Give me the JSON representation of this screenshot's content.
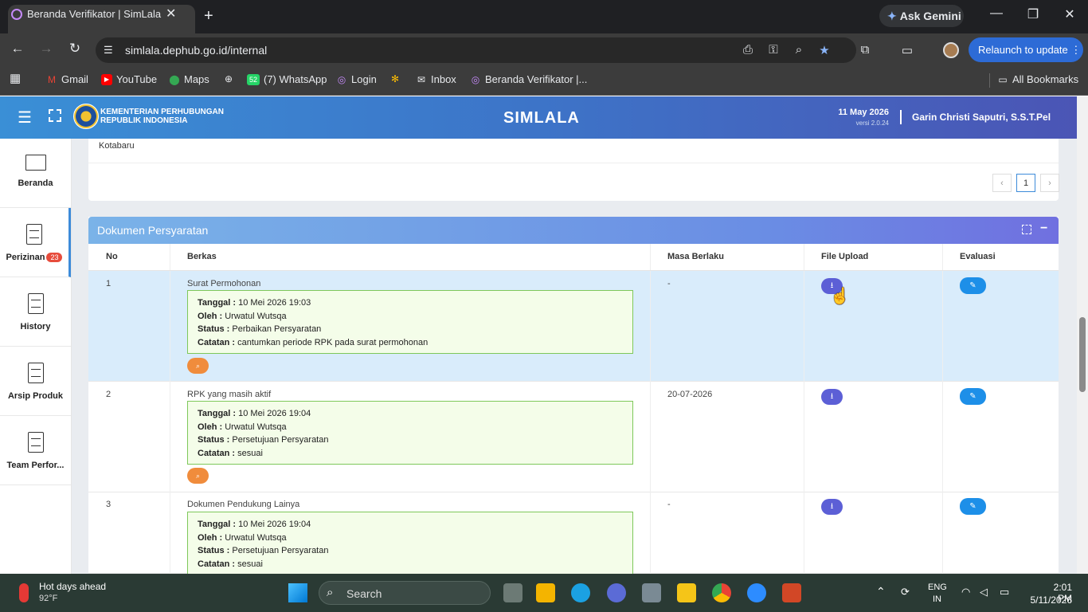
{
  "browser": {
    "tab_title": "Beranda Verifikator | SimLala",
    "url": "simlala.dephub.go.id/internal",
    "gemini_label": "Ask Gemini",
    "relaunch_label": "Relaunch to update",
    "bookmarks": [
      "Gmail",
      "YouTube",
      "Maps",
      "(7) WhatsApp",
      "Login",
      "Inbox",
      "Beranda Verifikator |..."
    ],
    "whatsapp_badge": "52",
    "all_bookmarks": "All Bookmarks"
  },
  "header": {
    "org_line1": "KEMENTERIAN PERHUBUNGAN",
    "org_line2": "REPUBLIK INDONESIA",
    "app_name": "SIMLALA",
    "date": "11 May 2026",
    "version": "versi 2.0.24",
    "user": "Garin Christi Saputri, S.S.T.Pel"
  },
  "sidebar": {
    "items": [
      {
        "label": "Beranda",
        "icon": "monitor-icon"
      },
      {
        "label": "Perizinan",
        "icon": "document-icon",
        "badge": "23"
      },
      {
        "label": "History",
        "icon": "document-icon"
      },
      {
        "label": "Arsip Produk",
        "icon": "document-icon"
      },
      {
        "label": "Team Perfor...",
        "icon": "document-icon"
      }
    ]
  },
  "previous_card": {
    "location": "Kotabaru",
    "pagination": {
      "prev": "‹",
      "current": "1",
      "next": "›"
    }
  },
  "documents": {
    "title": "Dokumen Persyaratan",
    "columns": [
      "No",
      "Berkas",
      "Masa Berlaku",
      "File Upload",
      "Evaluasi"
    ],
    "labels": {
      "tanggal": "Tanggal :",
      "oleh": "Oleh :",
      "status": "Status :",
      "catatan": "Catatan :"
    },
    "rows": [
      {
        "no": "1",
        "name": "Surat Permohonan",
        "tanggal": "10 Mei 2026 19:03",
        "oleh": "Urwatul Wutsqa",
        "status": "Perbaikan Persyaratan",
        "catatan": "cantumkan periode RPK pada surat permohonan",
        "masa_berlaku": "-"
      },
      {
        "no": "2",
        "name": "RPK yang masih aktif",
        "tanggal": "10 Mei 2026 19:04",
        "oleh": "Urwatul Wutsqa",
        "status": "Persetujuan Persyaratan",
        "catatan": "sesuai",
        "masa_berlaku": "20-07-2026"
      },
      {
        "no": "3",
        "name": "Dokumen Pendukung Lainya",
        "tanggal": "10 Mei 2026 19:04",
        "oleh": "Urwatul Wutsqa",
        "status": "Persetujuan Persyaratan",
        "catatan": "sesuai",
        "masa_berlaku": "-"
      }
    ]
  },
  "taskbar": {
    "weather_title": "Hot days ahead",
    "weather_temp": "92°F",
    "search_placeholder": "Search",
    "lang1": "ENG",
    "lang2": "IN",
    "time": "2:01 PM",
    "date": "5/11/2026"
  },
  "colors": {
    "header_start": "#3a8fd6",
    "header_end": "#4b55b5",
    "note_bg": "#f4fde9",
    "note_border": "#7ec85a",
    "download_btn": "#5c5fd6",
    "edit_btn": "#1d8fe8",
    "view_btn": "#f08c3c",
    "active_row": "#d9ecfb"
  }
}
